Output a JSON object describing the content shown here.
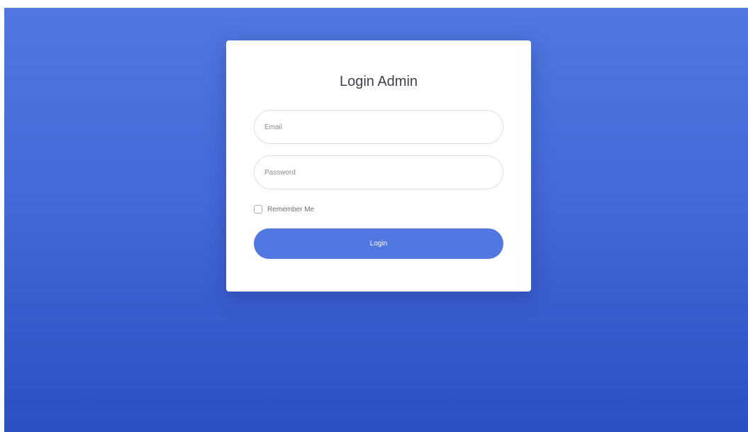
{
  "card": {
    "title": "Login Admin"
  },
  "form": {
    "email_placeholder": "Email",
    "password_placeholder": "Password",
    "remember_label": "Remember Me",
    "remember_checked": false,
    "login_label": "Login"
  },
  "colors": {
    "background_top": "#5178e0",
    "background_bottom": "#2c4fc2",
    "button": "#5277e0",
    "card": "#ffffff"
  }
}
